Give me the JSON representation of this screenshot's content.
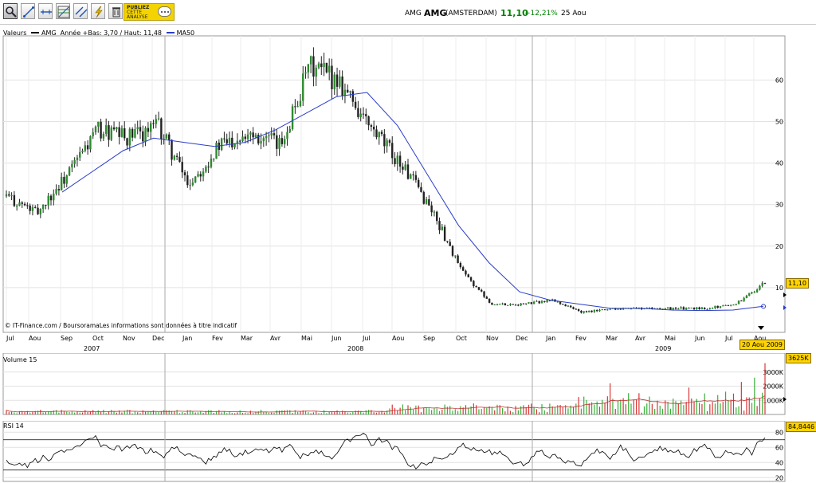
{
  "toolbar": {
    "tools": [
      "zoom-icon",
      "trendline-icon",
      "horizontal-line-icon",
      "fibonacci-icon",
      "parallel-lines-icon",
      "lightning-icon",
      "trash-icon"
    ],
    "publiez_line1": "PUBLIEZ",
    "publiez_line2": "CETTE",
    "publiez_line3": "ANALYSE"
  },
  "quote": {
    "ticker": "AMG",
    "ticker_big": "AMG",
    "exchange": "(AMSTERDAM)",
    "last": "11,10",
    "change": "+12,21%",
    "date": "25 Aou"
  },
  "price_panel": {
    "label_valeurs": "Valeurs",
    "label_series": "AMG",
    "label_range": "Année +Bas: 3,70 / Haut: 11,48",
    "label_ma": "MA50",
    "last_tag": "11,10",
    "credit": "© IT-Finance.com / BoursoramaLes informations sont données à titre indicatif"
  },
  "volume_panel": {
    "label": "Volume 15",
    "last_tag": "3625K"
  },
  "rsi_panel": {
    "label": "RSI 14",
    "last_tag": "84,8446"
  },
  "x_axis": {
    "months": [
      "Jul",
      "Aou",
      "Sep",
      "Oct",
      "Nov",
      "Dec",
      "Jan",
      "Fev",
      "Mar",
      "Avr",
      "Mai",
      "Jun",
      "Jul",
      "Aou",
      "Sep",
      "Oct",
      "Nov",
      "Dec",
      "Jan",
      "Fev",
      "Mar",
      "Avr",
      "Mai",
      "Jun",
      "Jul",
      "Aou"
    ],
    "years": [
      "2007",
      "2008",
      "2009"
    ],
    "date_tag": "20 Aou 2009"
  },
  "colors": {
    "ma": "#2a3dc8",
    "up": "#2c8c2c",
    "down": "#222222",
    "vol_up": "#38b038",
    "vol_down": "#d83838",
    "tag": "#ffd400"
  },
  "chart_data": [
    {
      "type": "line",
      "title": "AMG",
      "series": [
        {
          "name": "AMG",
          "x": [
            "2007-07",
            "2007-08",
            "2007-09",
            "2007-10",
            "2007-11",
            "2007-12",
            "2008-01",
            "2008-02",
            "2008-03",
            "2008-04",
            "2008-05",
            "2008-06",
            "2008-07",
            "2008-08",
            "2008-09",
            "2008-10",
            "2008-11",
            "2008-12",
            "2009-01",
            "2009-02",
            "2009-03",
            "2009-04",
            "2009-05",
            "2009-06",
            "2009-07",
            "2009-08"
          ],
          "values": [
            32,
            28,
            37,
            48,
            46,
            49,
            35,
            44,
            48,
            44,
            63,
            60,
            48,
            40,
            29,
            14,
            6,
            6,
            7,
            4,
            5,
            5,
            5,
            5,
            6,
            11.1
          ]
        },
        {
          "name": "MA50",
          "x": [
            "2007-09",
            "2007-10",
            "2007-11",
            "2007-12",
            "2008-01",
            "2008-02",
            "2008-03",
            "2008-04",
            "2008-05",
            "2008-06",
            "2008-07",
            "2008-08",
            "2008-09",
            "2008-10",
            "2008-11",
            "2008-12",
            "2009-01",
            "2009-02",
            "2009-03",
            "2009-04",
            "2009-05",
            "2009-06",
            "2009-07",
            "2009-08"
          ],
          "values": [
            33,
            38,
            43,
            46,
            45,
            44,
            45,
            48,
            52,
            56,
            57,
            49,
            37,
            25,
            16,
            9,
            7,
            6,
            5,
            5,
            4.6,
            4.5,
            4.6,
            5.5
          ]
        }
      ],
      "ylim": [
        0,
        70
      ],
      "yticks": [
        10,
        20,
        30,
        40,
        50,
        60
      ]
    },
    {
      "type": "bar",
      "title": "Volume 15",
      "yticks_labels": [
        "1000K",
        "2000K",
        "3000K"
      ],
      "ylim": [
        0,
        4000
      ],
      "last_value_label": "3625K"
    },
    {
      "type": "line",
      "title": "RSI 14",
      "yticks": [
        20,
        40,
        60,
        80
      ],
      "ylim": [
        15,
        95
      ],
      "reference_lines": [
        30,
        70
      ],
      "last_value_label": "84,8446"
    }
  ]
}
